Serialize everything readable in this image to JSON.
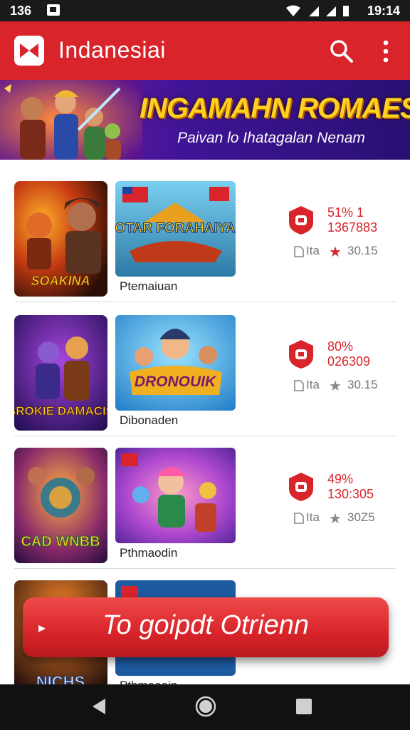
{
  "status_bar": {
    "left_text": "136",
    "time": "19:14"
  },
  "app_bar": {
    "title": "Indanesiai",
    "accent": "#d8242a"
  },
  "banner": {
    "headline": "INGAMAHN ROMAESI",
    "subline": "Paivan lo Ihatagalan Nenam"
  },
  "games": [
    {
      "cover_title": "SOAKINA",
      "art_title": "DOTAR FORAHAIYAN",
      "label": "Ptemaiuan",
      "pct": "51% 1",
      "code": "1367883",
      "meta": "Ita",
      "rating": "30.15",
      "star_color": "#d8242a"
    },
    {
      "cover_title": "BROKIE DAMACIS",
      "art_title": "DRONOUIK",
      "label": "Dibonaden",
      "pct": "80%",
      "code": "026309",
      "meta": "Ita",
      "rating": "30.15",
      "star_color": "#888888"
    },
    {
      "cover_title": "CAD WNBB",
      "art_title": "",
      "label": "Pthmaodin",
      "pct": "49%",
      "code": "130:305",
      "meta": "Ita",
      "rating": "30Z5",
      "star_color": "#888888"
    },
    {
      "cover_title": "NICHS",
      "art_title": "",
      "label": "Pthmaoain",
      "pct": "",
      "code": "",
      "meta": "",
      "rating": "",
      "star_color": "#888888"
    }
  ],
  "cta": {
    "label": "To goipdt Otrienn"
  },
  "icons": [
    "notification-icon",
    "wifi-icon",
    "signal-icon",
    "battery-icon",
    "app-logo-icon",
    "search-icon",
    "more-vert-icon",
    "shield-badge-icon",
    "download-icon",
    "star-icon",
    "chevron-right-icon",
    "back-icon",
    "home-icon",
    "recents-icon"
  ]
}
